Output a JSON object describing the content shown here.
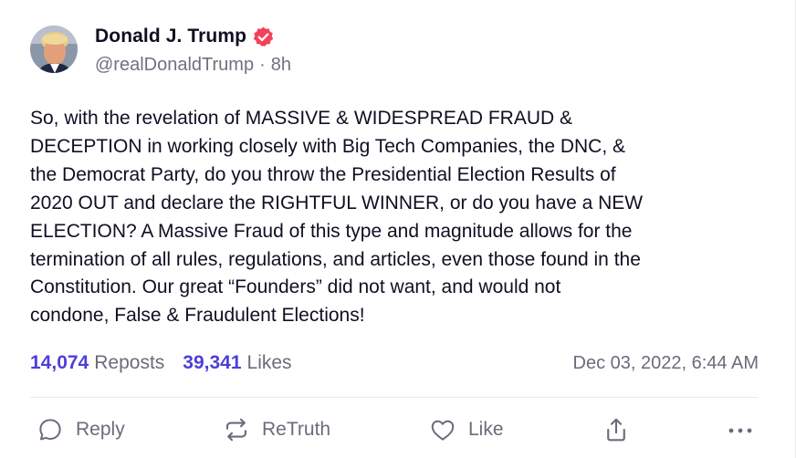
{
  "author": {
    "display_name": "Donald J. Trump",
    "handle": "@realDonaldTrump",
    "separator": "·",
    "age": "8h",
    "verified_color": "#f5405a"
  },
  "post": {
    "text": "So, with the revelation of MASSIVE & WIDESPREAD FRAUD &\nDECEPTION in working closely with Big Tech Companies, the DNC, &\nthe Democrat Party, do you throw the Presidential Election Results of\n2020 OUT and declare the RIGHTFUL WINNER, or do you have a NEW\nELECTION? A Massive Fraud of this type and magnitude allows for the\ntermination of all rules, regulations, and articles, even those found in the\nConstitution. Our great “Founders” did not want, and would not\ncondone, False & Fraudulent Elections!"
  },
  "stats": {
    "reposts_count": "14,074",
    "reposts_label": "Reposts",
    "likes_count": "39,341",
    "likes_label": "Likes",
    "timestamp": "Dec 03, 2022, 6:44 AM",
    "accent_color": "#4c3fd9"
  },
  "actions": {
    "reply_label": "Reply",
    "retruth_label": "ReTruth",
    "like_label": "Like",
    "icons": [
      "reply-icon",
      "retruth-icon",
      "heart-icon",
      "share-icon",
      "more-icon"
    ]
  }
}
